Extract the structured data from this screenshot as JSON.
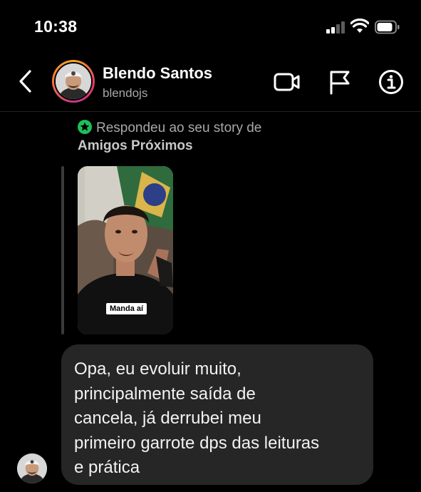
{
  "status_bar": {
    "time": "10:38",
    "signal_bars": 2,
    "signal_bars_total": 4
  },
  "header": {
    "back_icon": "chevron-left-icon",
    "name": "Blendo Santos",
    "username": "blendojs",
    "icons": [
      "video-call-icon",
      "flag-icon",
      "info-icon"
    ]
  },
  "story_reply": {
    "line1": "Respondeu ao seu story de",
    "line2": "Amigos Próximos",
    "caption": "Manda aí",
    "badge_icon": "close-friends-star-icon",
    "badge_color": "#1fbe5b"
  },
  "message": {
    "lines": [
      "Opa, eu evoluir muito,",
      "principalmente saída de",
      "cancela, já derrubei meu",
      "primeiro garrote dps das leituras",
      "e prática"
    ]
  },
  "colors": {
    "background": "#000000",
    "bubble": "#262626",
    "muted_text": "#a8a8a8",
    "accent_ring": "#e4405f"
  }
}
